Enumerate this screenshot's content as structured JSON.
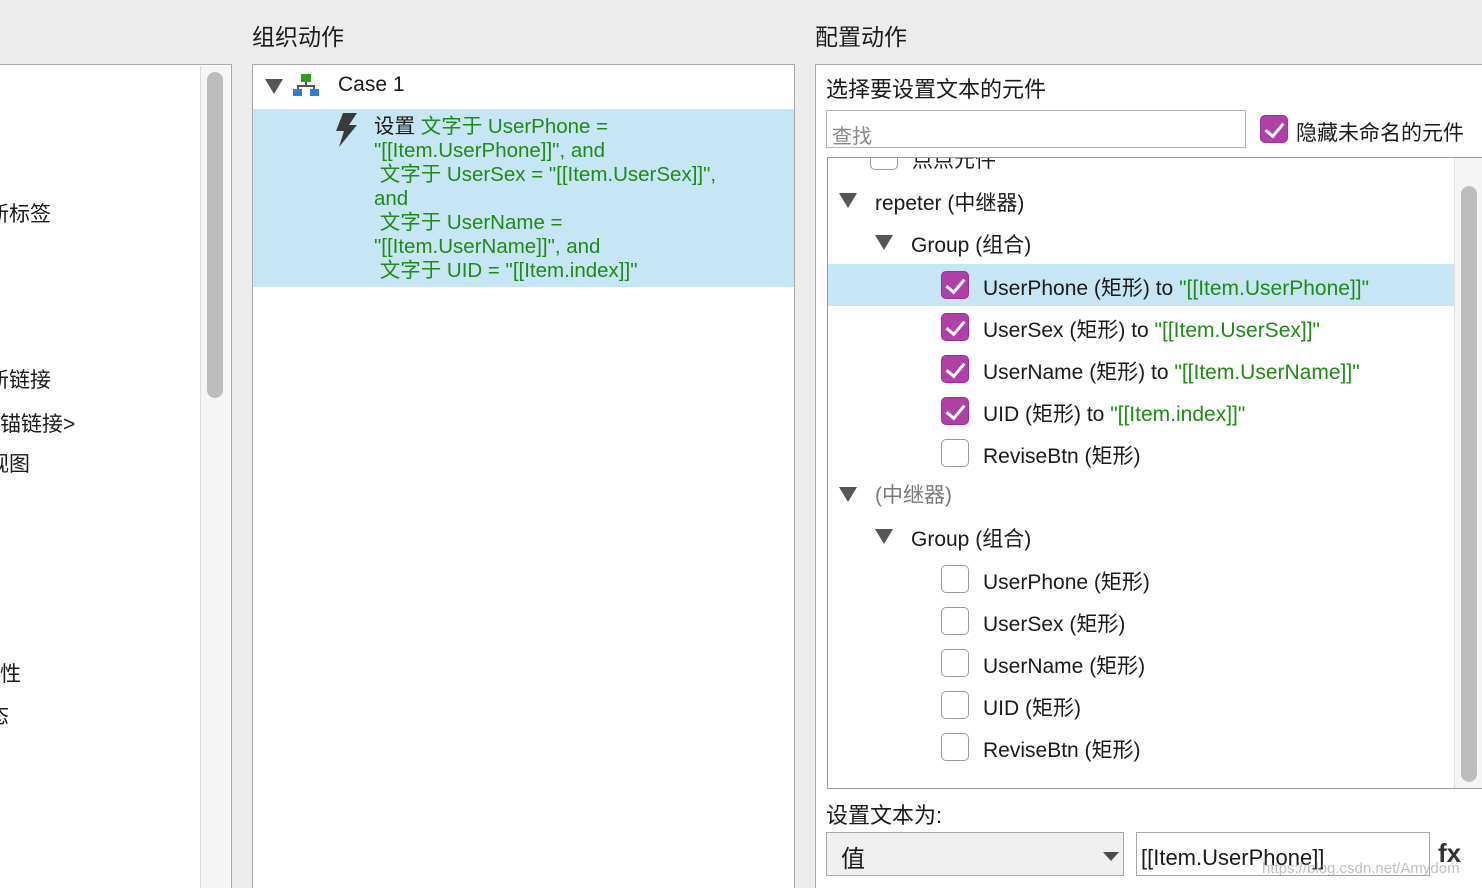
{
  "left_panel": {
    "items": [
      "新标签",
      "新链接",
      "锚链接>",
      "视图",
      "性",
      "态"
    ]
  },
  "organize": {
    "title": "组织动作",
    "case_label": "Case 1",
    "action_prefix": "设置",
    "action_lines": [
      "文字于 UserPhone =",
      "\"[[Item.UserPhone]]\", and",
      " 文字于 UserSex = \"[[Item.UserSex]]\",",
      "and",
      " 文字于 UserName =",
      "\"[[Item.UserName]]\", and",
      " 文字于 UID = \"[[Item.index]]\""
    ]
  },
  "configure": {
    "title": "配置动作",
    "select_label": "选择要设置文本的元件",
    "search_placeholder": "查找",
    "hide_unnamed_label": "隐藏未命名的元件",
    "hide_unnamed_checked": true,
    "tree": {
      "clipped_item": "点点元件",
      "repeater1": {
        "label": "repeter (中继器)",
        "group_label": "Group (组合)",
        "items": [
          {
            "name": "UserPhone (矩形)",
            "to": " to ",
            "value": "\"[[Item.UserPhone]]\"",
            "checked": true,
            "selected": true
          },
          {
            "name": "UserSex (矩形)",
            "to": " to ",
            "value": "\"[[Item.UserSex]]\"",
            "checked": true,
            "selected": false
          },
          {
            "name": "UserName (矩形)",
            "to": " to ",
            "value": "\"[[Item.UserName]]\"",
            "checked": true,
            "selected": false
          },
          {
            "name": "UID (矩形)",
            "to": " to ",
            "value": "\"[[Item.index]]\"",
            "checked": true,
            "selected": false
          },
          {
            "name": "ReviseBtn (矩形)",
            "to": "",
            "value": "",
            "checked": false,
            "selected": false
          }
        ]
      },
      "repeater2": {
        "label": "(中继器)",
        "group_label": "Group (组合)",
        "items": [
          {
            "name": "UserPhone (矩形)",
            "checked": false
          },
          {
            "name": "UserSex (矩形)",
            "checked": false
          },
          {
            "name": "UserName (矩形)",
            "checked": false
          },
          {
            "name": "UID (矩形)",
            "checked": false
          },
          {
            "name": "ReviseBtn (矩形)",
            "checked": false
          }
        ]
      }
    },
    "set_text_label": "设置文本为:",
    "value_type": "值",
    "value_input": "[[Item.UserPhone]]",
    "fx_label": "fx",
    "watermark": "https://blog.csdn.net/Amydom"
  },
  "colors": {
    "selection": "#c7e6f5",
    "checkbox": "#b03fa8",
    "green_text": "#1f8a15"
  }
}
